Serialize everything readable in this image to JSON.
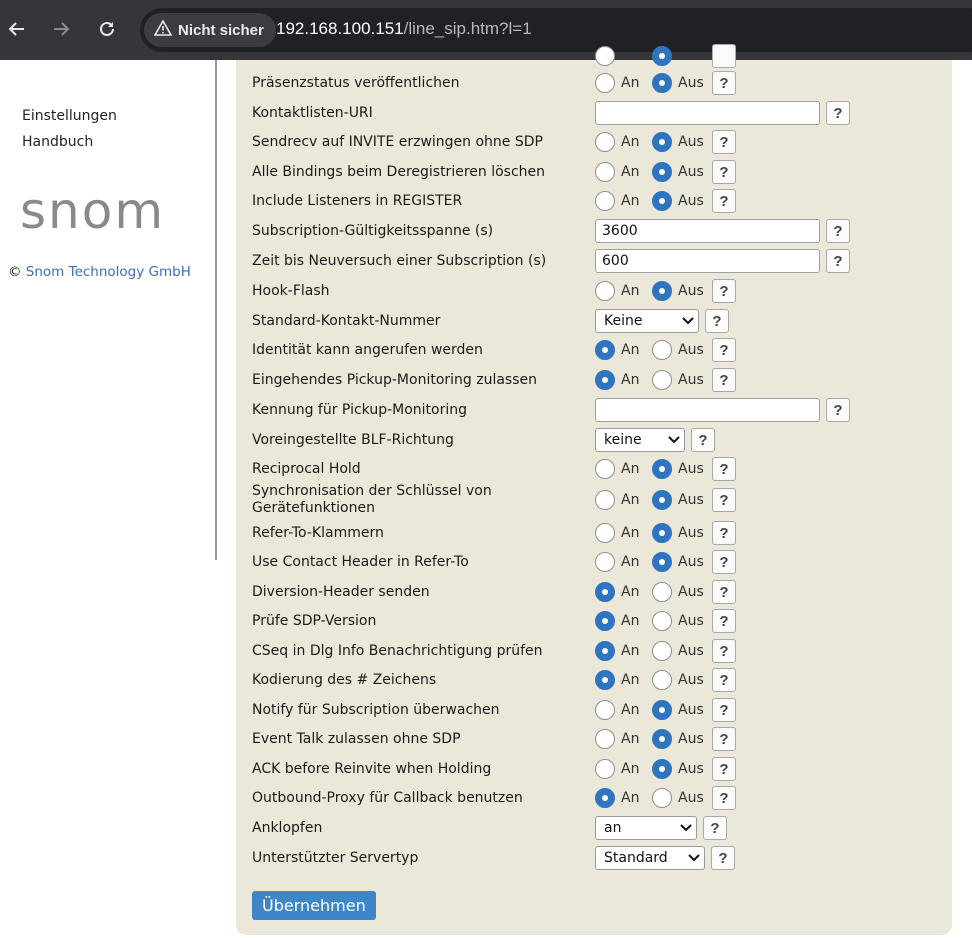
{
  "browser": {
    "security_label": "Nicht sicher",
    "url_host": "192.168.100.151",
    "url_path": "/line_sip.htm?l=1"
  },
  "sidebar": {
    "partial_link": "Einstellungen",
    "manual_link": "Handbuch",
    "logo_text": "snom",
    "copyright_symbol": "©",
    "company": "Snom Technology GmbH"
  },
  "options": {
    "on": "An",
    "off": "Aus",
    "help": "?"
  },
  "rows": [
    {
      "label": "Präsenzstatus veröffentlichen",
      "type": "radio",
      "value": "off"
    },
    {
      "label": "Kontaktlisten-URI",
      "type": "text",
      "value": ""
    },
    {
      "label": "Sendrecv auf INVITE erzwingen ohne SDP",
      "type": "radio",
      "value": "off"
    },
    {
      "label": "Alle Bindings beim Deregistrieren löschen",
      "type": "radio",
      "value": "off"
    },
    {
      "label": "Include Listeners in REGISTER",
      "type": "radio",
      "value": "off"
    },
    {
      "label": "Subscription-Gültigkeitsspanne (s)",
      "type": "text",
      "value": "3600"
    },
    {
      "label": "Zeit bis Neuversuch einer Subscription (s)",
      "type": "text",
      "value": "600"
    },
    {
      "label": "Hook-Flash",
      "type": "radio",
      "value": "off"
    },
    {
      "label": "Standard-Kontakt-Nummer",
      "type": "select",
      "value": "Keine"
    },
    {
      "label": "Identität kann angerufen werden",
      "type": "radio",
      "value": "on"
    },
    {
      "label": "Eingehendes Pickup-Monitoring zulassen",
      "type": "radio",
      "value": "on"
    },
    {
      "label": "Kennung für Pickup-Monitoring",
      "type": "text",
      "value": ""
    },
    {
      "label": "Voreingestellte BLF-Richtung",
      "type": "select",
      "value": "keine"
    },
    {
      "label": "Reciprocal Hold",
      "type": "radio",
      "value": "off"
    },
    {
      "label": "Synchronisation der Schlüssel von Gerätefunktionen",
      "type": "radio",
      "value": "off"
    },
    {
      "label": "Refer-To-Klammern",
      "type": "radio",
      "value": "off"
    },
    {
      "label": "Use Contact Header in Refer-To",
      "type": "radio",
      "value": "off"
    },
    {
      "label": "Diversion-Header senden",
      "type": "radio",
      "value": "on"
    },
    {
      "label": "Prüfe SDP-Version",
      "type": "radio",
      "value": "on"
    },
    {
      "label": "CSeq in Dlg Info Benachrichtigung prüfen",
      "type": "radio",
      "value": "on"
    },
    {
      "label": "Kodierung des # Zeichens",
      "type": "radio",
      "value": "on"
    },
    {
      "label": "Notify für Subscription überwachen",
      "type": "radio",
      "value": "off"
    },
    {
      "label": "Event Talk zulassen ohne SDP",
      "type": "radio",
      "value": "off"
    },
    {
      "label": "ACK before Reinvite when Holding",
      "type": "radio",
      "value": "off"
    },
    {
      "label": "Outbound-Proxy für Callback benutzen",
      "type": "radio",
      "value": "on"
    },
    {
      "label": "Anklopfen",
      "type": "select",
      "value": "an"
    },
    {
      "label": "Unterstützter Servertyp",
      "type": "select",
      "value": "Standard"
    }
  ],
  "submit_label": "Übernehmen"
}
